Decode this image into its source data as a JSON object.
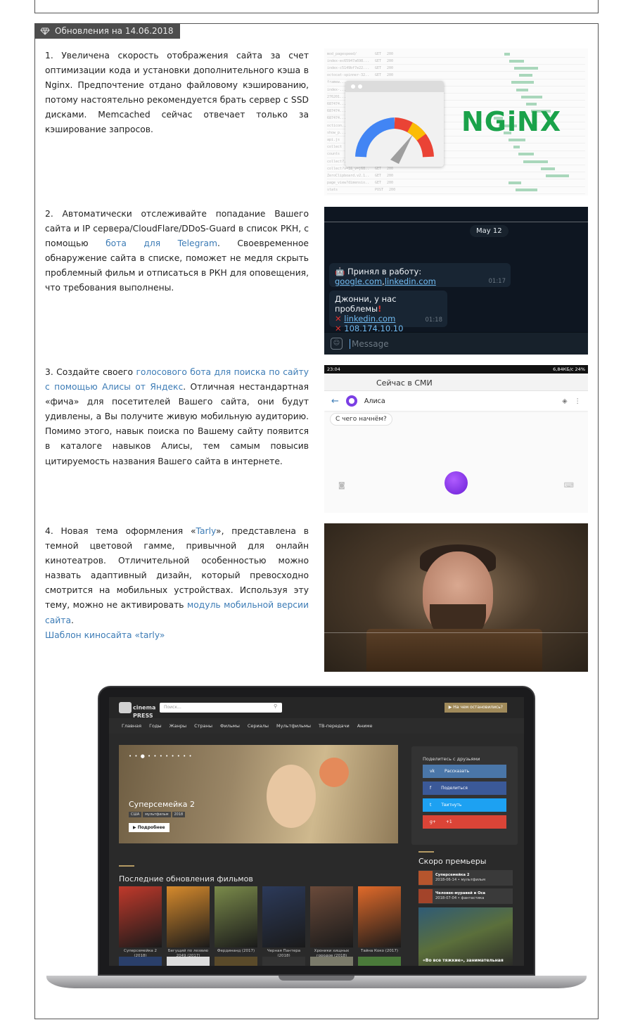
{
  "header": {
    "title": "Обновления на 14.06.2018"
  },
  "sections": [
    {
      "n": "1.",
      "text": "Увеличена скорость отображения сайта за счет оптимизации кода и установки дополнительного кэша в Nginx. Предпочтение отдано файловому кэшированию, потому настоятельно рекомендуется брать сервер с SSD дисками. Memcached сейчас отвечает только за кэширование запросов."
    },
    {
      "n": "2.",
      "text_a": "Автоматически отслеживайте попадание Вашего сайта и IP сервера/CloudFlare/DDoS-Guard в список РКН, с помощью ",
      "link": "бота для Telegram",
      "text_b": ". Своевременное обнаружение сайта в списке, поможет не медля скрыть проблемный фильм и отписаться в РКН для оповещения, что требования выполнены."
    },
    {
      "n": "3.",
      "text_a": "Создайте своего ",
      "link": "голосового бота для поиска по сайту с помощью Алисы от Яндекс",
      "text_b": ". Отличная нестандартная «фича» для посетителей Вашего сайта, они будут удивлены, а Вы получите живую мобильную аудиторию. Помимо этого, навык поиска по Вашему сайту появится в каталоге навыков Алисы, тем самым повысив цитируемость названия Вашего сайта в интернете."
    },
    {
      "n": "4.",
      "text_a": "Новая тема оформления «",
      "link": "Tarly",
      "text_b": "», представлена в темной цветовой гамме, привычной для онлайн кинотеатров. Отличительной особенностью можно назвать адаптивный дизайн, который превосходно смотрится на мобильных устройствах. Используя эту тему, можно не активировать ",
      "link2": "модуль мобильной версии сайта",
      "text_c": ".",
      "template_link": "Шаблон киносайта «tarly»"
    }
  ],
  "devtools": {
    "rows": [
      {
        "name": "mod_pagespeed/",
        "m": "GET",
        "s": "200"
      },
      {
        "name": "index-ec65947a698...",
        "m": "GET",
        "s": "200"
      },
      {
        "name": "index-c5149bf7e22...",
        "m": "GET",
        "s": "200"
      },
      {
        "name": "octocat-spinner-32...",
        "m": "GET",
        "s": "200"
      },
      {
        "name": "framew...",
        "m": "",
        "s": ""
      },
      {
        "name": "index-...",
        "m": "",
        "s": ""
      },
      {
        "name": "276201...",
        "m": "",
        "s": ""
      },
      {
        "name": "687474...",
        "m": "",
        "s": ""
      },
      {
        "name": "687474...",
        "m": "",
        "s": ""
      },
      {
        "name": "687474...",
        "m": "",
        "s": ""
      },
      {
        "name": "octicon...",
        "m": "",
        "s": ""
      },
      {
        "name": "show_p...",
        "m": "",
        "s": ""
      },
      {
        "name": "api.js",
        "m": "",
        "s": ""
      },
      {
        "name": "collect",
        "m": "",
        "s": ""
      },
      {
        "name": "counts",
        "m": "",
        "s": ""
      },
      {
        "name": "collect?...",
        "m": "",
        "s": ""
      },
      {
        "name": "collect?v=1&_v=j68...",
        "m": "GET",
        "s": "200"
      },
      {
        "name": "ZeroClipboard.v2.1...",
        "m": "GET",
        "s": "200"
      },
      {
        "name": "page_view?dimensio...",
        "m": "GET",
        "s": "200"
      },
      {
        "name": "stats",
        "m": "POST",
        "s": "200"
      }
    ],
    "nginx_label": "NGiNX"
  },
  "telegram": {
    "date": "May 12",
    "msg1_prefix": "Принял в работу: ",
    "msg1_link1": "google.com",
    "msg1_sep": ",",
    "msg1_link2": "linkedin.com",
    "msg1_time": "01:17",
    "msg2_title": "Джонни, у нас проблемы",
    "msg2_link1": "linkedin.com",
    "msg2_link2": "108.174.10.10",
    "msg2_time": "01:18",
    "input_placeholder": "Message"
  },
  "alisa": {
    "status_time": "23:04",
    "status_right": "6,84КБ/с  24%",
    "under_title": "Сейчас в СМИ",
    "bot_name": "Алиса",
    "chip": "С чего начнём?"
  },
  "cinemapress": {
    "logo_top": "cinema",
    "logo_bottom": "PRESS",
    "search_placeholder": "Поиск...",
    "top_button": "На чем остановились?",
    "nav": [
      "Главная",
      "Годы",
      "Жанры",
      "Страны",
      "Фильмы",
      "Сериалы",
      "Мультфильмы",
      "ТВ-передачи",
      "Аниме"
    ],
    "hero_title": "Суперсемейка 2",
    "hero_tags": [
      "США",
      "мультфильм",
      "2018"
    ],
    "hero_more": "Подробнее",
    "share_title": "Поделитесь с друзьями",
    "share_buttons": [
      {
        "label": "Рассказать",
        "color": "#4a76a8"
      },
      {
        "label": "Поделиться",
        "color": "#3b5998"
      },
      {
        "label": "Твитнуть",
        "color": "#1da1f2"
      },
      {
        "label": "+1",
        "color": "#db4437"
      }
    ],
    "latest_title": "Последние обновления фильмов",
    "posters": [
      {
        "cap": "Суперсемейка 2 (2018)",
        "color": "#c0392b"
      },
      {
        "cap": "Бегущий по лезвию 2049 (2017)",
        "color": "#d68a2c"
      },
      {
        "cap": "Фердинанд (2017)",
        "color": "#7a8a4a"
      },
      {
        "cap": "Черная Пантера (2018)",
        "color": "#2c3a5a"
      },
      {
        "cap": "Хроники хищных городов (2018)",
        "color": "#6a4a3a"
      },
      {
        "cap": "Тайна Коко (2017)",
        "color": "#e06a2a"
      }
    ],
    "soon_title": "Скоро премьеры",
    "soon": [
      {
        "title": "Суперсемейка 2",
        "meta": "2018-06-14  •  мультфильм"
      },
      {
        "title": "Человек-муравей и Оса",
        "meta": "2018-07-04  •  фантастика"
      }
    ],
    "soon_big": "«Во все тяжкие», занимательная"
  }
}
